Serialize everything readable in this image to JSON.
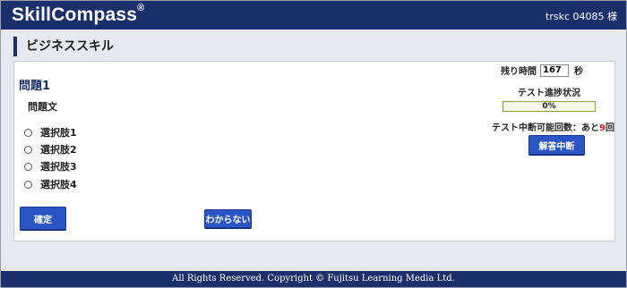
{
  "header": {
    "logo_text": "SkillCompass",
    "logo_mark": "®",
    "user_label": "trskc 04085 様"
  },
  "section": {
    "title": "ビジネススキル"
  },
  "question": {
    "number": "問題1",
    "text": "問題文",
    "choices": [
      "選択肢1",
      "選択肢2",
      "選択肢3",
      "選択肢4"
    ]
  },
  "buttons": {
    "confirm": "確定",
    "dont_know": "わからない",
    "suspend": "解答中断"
  },
  "status": {
    "time_label": "残り時間",
    "time_value": "167",
    "time_unit": "秒",
    "progress_label": "テスト進捗状況",
    "progress_text": "0%",
    "progress_fraction": 0,
    "suspend_prefix": "テスト中断可能回数：あと",
    "suspend_count": "9",
    "suspend_suffix": "回"
  },
  "footer": {
    "text": "All Rights Reserved. Copyright © Fujitsu Learning Media Ltd."
  },
  "colors": {
    "brand_navy": "#1b2f6b",
    "button_blue": "#2b55c4",
    "progress_green": "#9fbe3a",
    "count_red": "#d21f1f"
  }
}
